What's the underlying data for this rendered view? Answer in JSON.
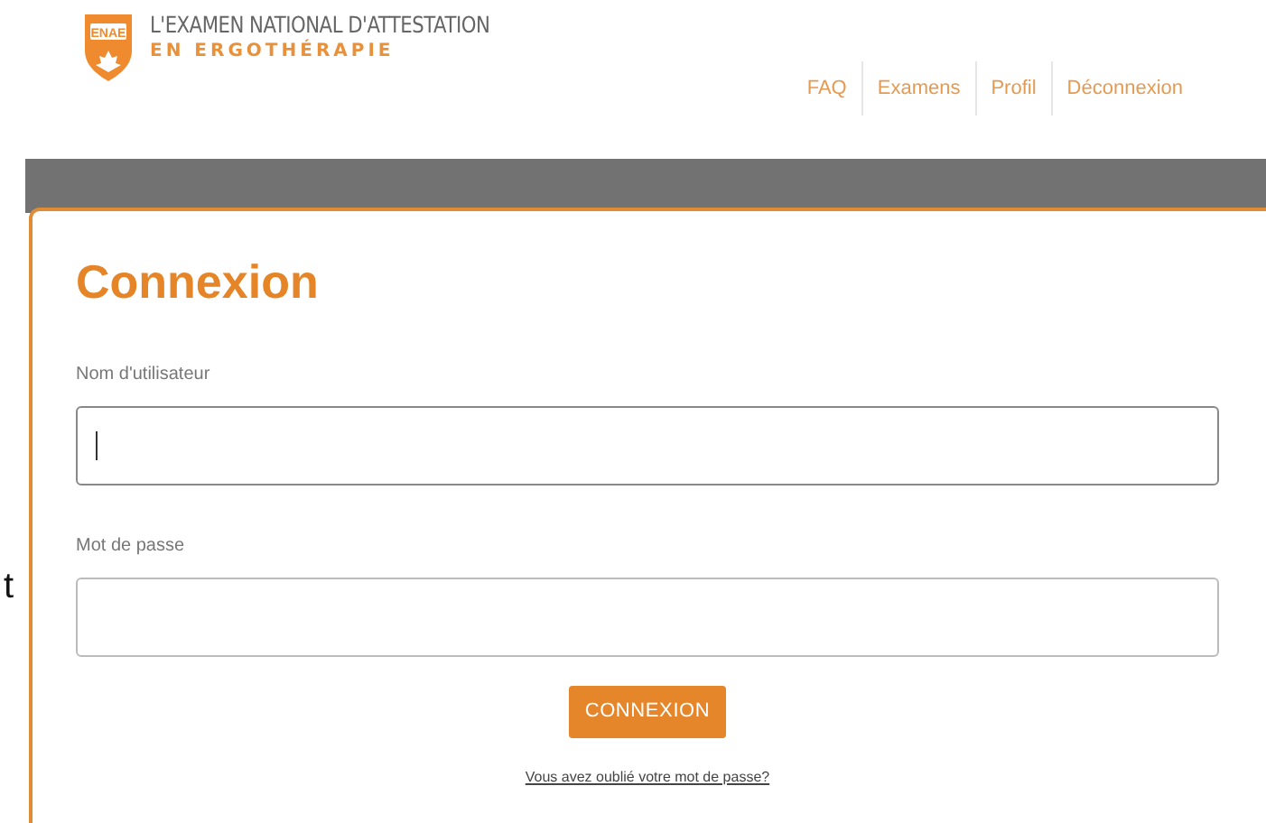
{
  "header": {
    "logo_badge": "ENAE",
    "title_line_1": "L'EXAMEN NATIONAL D'ATTESTATION",
    "title_line_2": "EN ERGOTHÉRAPIE"
  },
  "nav": [
    {
      "label": "FAQ"
    },
    {
      "label": "Examens"
    },
    {
      "label": "Profil"
    },
    {
      "label": "Déconnexion"
    }
  ],
  "side_fragment": "t",
  "login": {
    "title": "Connexion",
    "fields": [
      {
        "label": "Nom d'utilisateur",
        "focused": true
      },
      {
        "label": "Mot de passe",
        "focused": false
      }
    ],
    "submit": "CONNEXION",
    "forgot_link": "Vous avez oublié votre mot de passe?"
  }
}
